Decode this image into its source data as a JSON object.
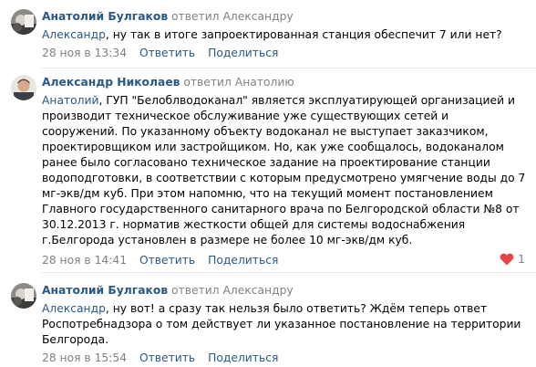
{
  "comments": [
    {
      "author": "Анатолий Булгаков",
      "replied_label": "ответил",
      "reply_to": "Александру",
      "mention": "Александр",
      "text": ", ну так в итоге запроектированная станция обеспечит 7 или нет?",
      "time": "28 ноя в 13:34",
      "reply_label": "Ответить",
      "share_label": "Поделиться"
    },
    {
      "author": "Александр Николаев",
      "replied_label": "ответил",
      "reply_to": "Анатолию",
      "mention": "Анатолий",
      "text": ", ГУП \"Белоблводоканал\" является эксплуатирующей организацией и производит техническое обслуживание уже существующих сетей и сооружений. По указанному объекту водоканал не выступает заказчиком, проектировщиком или застройщиком. Но, как уже сообщалось, водоканалом ранее было согласовано техническое задание на проектирование станции водоподготовки, в соответствии с которым предусмотрено умягчение воды до 7 мг-экв/дм куб. При этом напомню, что на текущий момент постановлением Главного государственного санитарного врача по Белгородской области №8 от 30.12.2013 г. норматив жесткости общей для системы водоснабжения г.Белгорода установлен в размере не более 10 мг-экв/дм куб.",
      "time": "28 ноя в 14:41",
      "reply_label": "Ответить",
      "share_label": "Поделиться",
      "likes": "1"
    },
    {
      "author": "Анатолий Булгаков",
      "replied_label": "ответил",
      "reply_to": "Александру",
      "mention": "Александр",
      "text": ", ну вот! а сразу так нельзя было ответить? Ждём теперь ответ Роспотребнадзора о том действует ли указанное постановление на территории Белгорода.",
      "time": "28 ноя в 15:54",
      "reply_label": "Ответить",
      "share_label": "Поделиться"
    }
  ],
  "colors": {
    "link": "#2a5885",
    "muted": "#828282",
    "like": "#e64646",
    "divider": "#e7e8ec"
  },
  "icons": {
    "like": "heart-icon"
  }
}
